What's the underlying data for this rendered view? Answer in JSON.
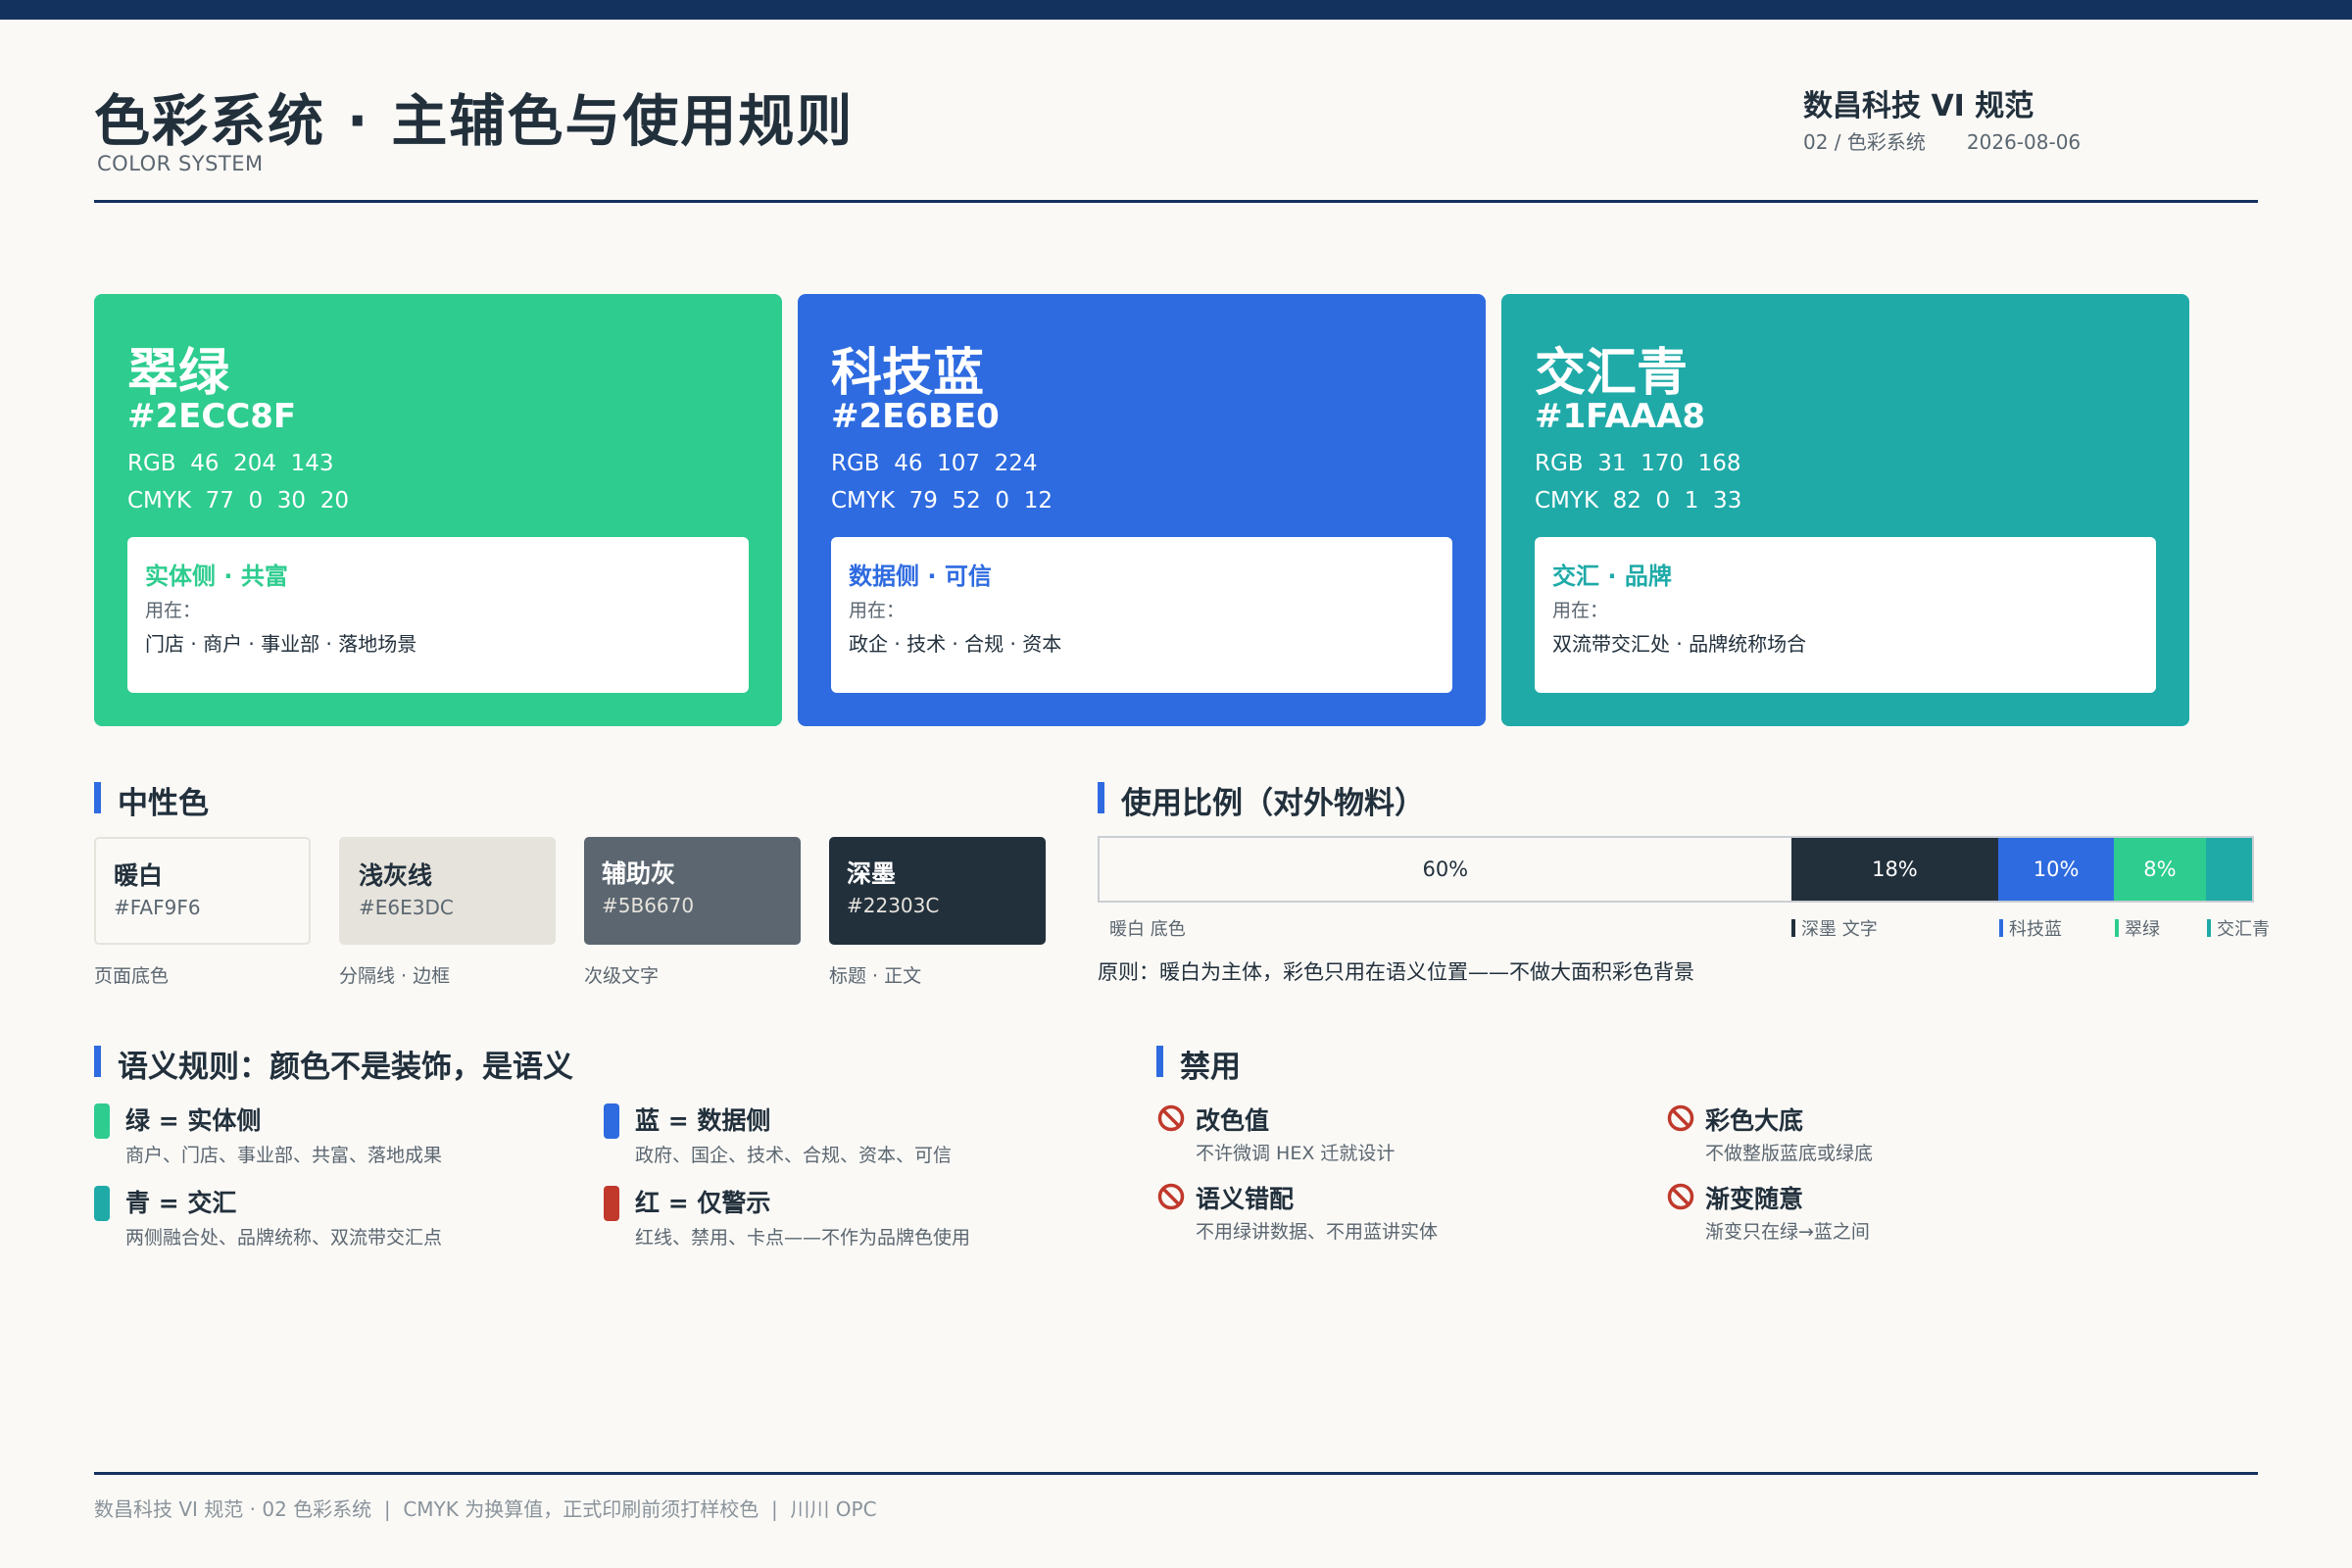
{
  "header": {
    "title": "色彩系统 · 主辅色与使用规则",
    "subtitle_en": "COLOR SYSTEM",
    "brand": "数昌科技 VI 规范",
    "section": "02 / 色彩系统",
    "date": "2026-08-06"
  },
  "primary_colors": [
    {
      "name": "翠绿",
      "hex": "#2ECC8F",
      "rgb": "RGB  46  204  143",
      "cmyk": "CMYK  77  0  30  20",
      "role": "实体侧 · 共富",
      "use_label": "用在：",
      "uses": "门店 · 商户 · 事业部 · 落地场景",
      "color": "#2ECC8F"
    },
    {
      "name": "科技蓝",
      "hex": "#2E6BE0",
      "rgb": "RGB  46  107  224",
      "cmyk": "CMYK  79  52  0  12",
      "role": "数据侧 · 可信",
      "use_label": "用在：",
      "uses": "政企 · 技术 · 合规 · 资本",
      "color": "#2E6BE0"
    },
    {
      "name": "交汇青",
      "hex": "#1FAAA8",
      "rgb": "RGB  31  170  168",
      "cmyk": "CMYK  82  0  1  33",
      "role": "交汇 · 品牌",
      "use_label": "用在：",
      "uses": "双流带交汇处 · 品牌统称场合",
      "color": "#1FAAA8"
    }
  ],
  "neutrals": {
    "heading": "中性色",
    "items": [
      {
        "name": "暖白",
        "hex": "#FAF9F6",
        "caption": "页面底色",
        "color": "#FAF9F6"
      },
      {
        "name": "浅灰线",
        "hex": "#E6E3DC",
        "caption": "分隔线 · 边框",
        "color": "#E6E3DC"
      },
      {
        "name": "辅助灰",
        "hex": "#5B6670",
        "caption": "次级文字",
        "color": "#5B6670"
      },
      {
        "name": "深墨",
        "hex": "#22303C",
        "caption": "标题 · 正文",
        "color": "#22303C"
      }
    ]
  },
  "usage": {
    "heading": "使用比例（对外物料）",
    "segments": [
      {
        "label": "暖白 底色",
        "value": 60,
        "display": "60%",
        "color": "#FAF9F6"
      },
      {
        "label": "深墨 文字",
        "value": 18,
        "display": "18%",
        "color": "#22303C"
      },
      {
        "label": "科技蓝",
        "value": 10,
        "display": "10%",
        "color": "#2E6BE0"
      },
      {
        "label": "翠绿",
        "value": 8,
        "display": "8%",
        "color": "#2ECC8F"
      },
      {
        "label": "交汇青",
        "value": 4,
        "display": "",
        "color": "#1FAAA8"
      }
    ],
    "principle": "原则：暖白为主体，彩色只用在语义位置——不做大面积彩色背景"
  },
  "semantics": {
    "heading": "语义规则：颜色不是装饰，是语义",
    "items": [
      {
        "title": "绿 = 实体侧",
        "desc": "商户、门店、事业部、共富、落地成果",
        "color": "#2ECC8F"
      },
      {
        "title": "蓝 = 数据侧",
        "desc": "政府、国企、技术、合规、资本、可信",
        "color": "#2E6BE0"
      },
      {
        "title": "青 = 交汇",
        "desc": "两侧融合处、品牌统称、双流带交汇点",
        "color": "#1FAAA8"
      },
      {
        "title": "红 = 仅警示",
        "desc": "红线、禁用、卡点——不作为品牌色使用",
        "color": "#C0392B"
      }
    ]
  },
  "banned": {
    "heading": "禁用",
    "icon": "ban-icon",
    "items": [
      {
        "title": "改色值",
        "desc": "不许微调 HEX 迁就设计"
      },
      {
        "title": "彩色大底",
        "desc": "不做整版蓝底或绿底"
      },
      {
        "title": "语义错配",
        "desc": "不用绿讲数据、不用蓝讲实体"
      },
      {
        "title": "渐变随意",
        "desc": "渐变只在绿→蓝之间"
      }
    ]
  },
  "footer": {
    "text": "数昌科技 VI 规范 · 02 色彩系统  |  CMYK 为换算值，正式印刷前须打样校色  |  川川 OPC"
  }
}
